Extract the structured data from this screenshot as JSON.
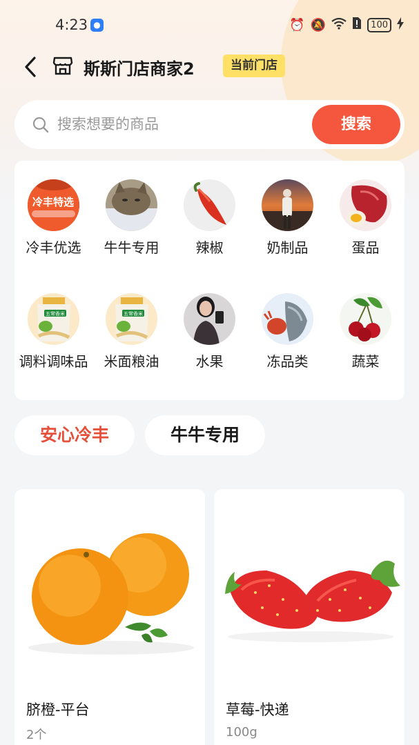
{
  "status_bar": {
    "time": "4:23",
    "battery": "100"
  },
  "header": {
    "store_name": "斯斯门店商家2",
    "badge": "当前门店"
  },
  "search": {
    "placeholder": "搜索想要的商品",
    "button_label": "搜索"
  },
  "categories": [
    {
      "label": "冷丰优选",
      "icon": "lengfeng-banner-image",
      "thumb_text": "冷丰特选"
    },
    {
      "label": "牛牛专用",
      "icon": "cat-photo-image"
    },
    {
      "label": "辣椒",
      "icon": "chili-pepper-image"
    },
    {
      "label": "奶制品",
      "icon": "sunset-person-image"
    },
    {
      "label": "蛋品",
      "icon": "meat-egg-image"
    },
    {
      "label": "调料调味品",
      "icon": "rice-bag-image",
      "thumb_text": "五常香米"
    },
    {
      "label": "米面粮油",
      "icon": "rice-bag-image",
      "thumb_text": "五常香米"
    },
    {
      "label": "水果",
      "icon": "woman-selfie-image"
    },
    {
      "label": "冻品类",
      "icon": "seafood-image"
    },
    {
      "label": "蔬菜",
      "icon": "cherries-image"
    }
  ],
  "tabs": [
    {
      "label": "安心冷丰",
      "active": true
    },
    {
      "label": "牛牛专用",
      "active": false
    }
  ],
  "products": [
    {
      "name": "脐橙-平台",
      "spec": "2个",
      "image": "oranges-image"
    },
    {
      "name": "草莓-快递",
      "spec": "100g",
      "image": "strawberries-image"
    }
  ],
  "colors": {
    "accent": "#f4573e",
    "badge": "#ffe067",
    "active_tab": "#e5503b"
  }
}
